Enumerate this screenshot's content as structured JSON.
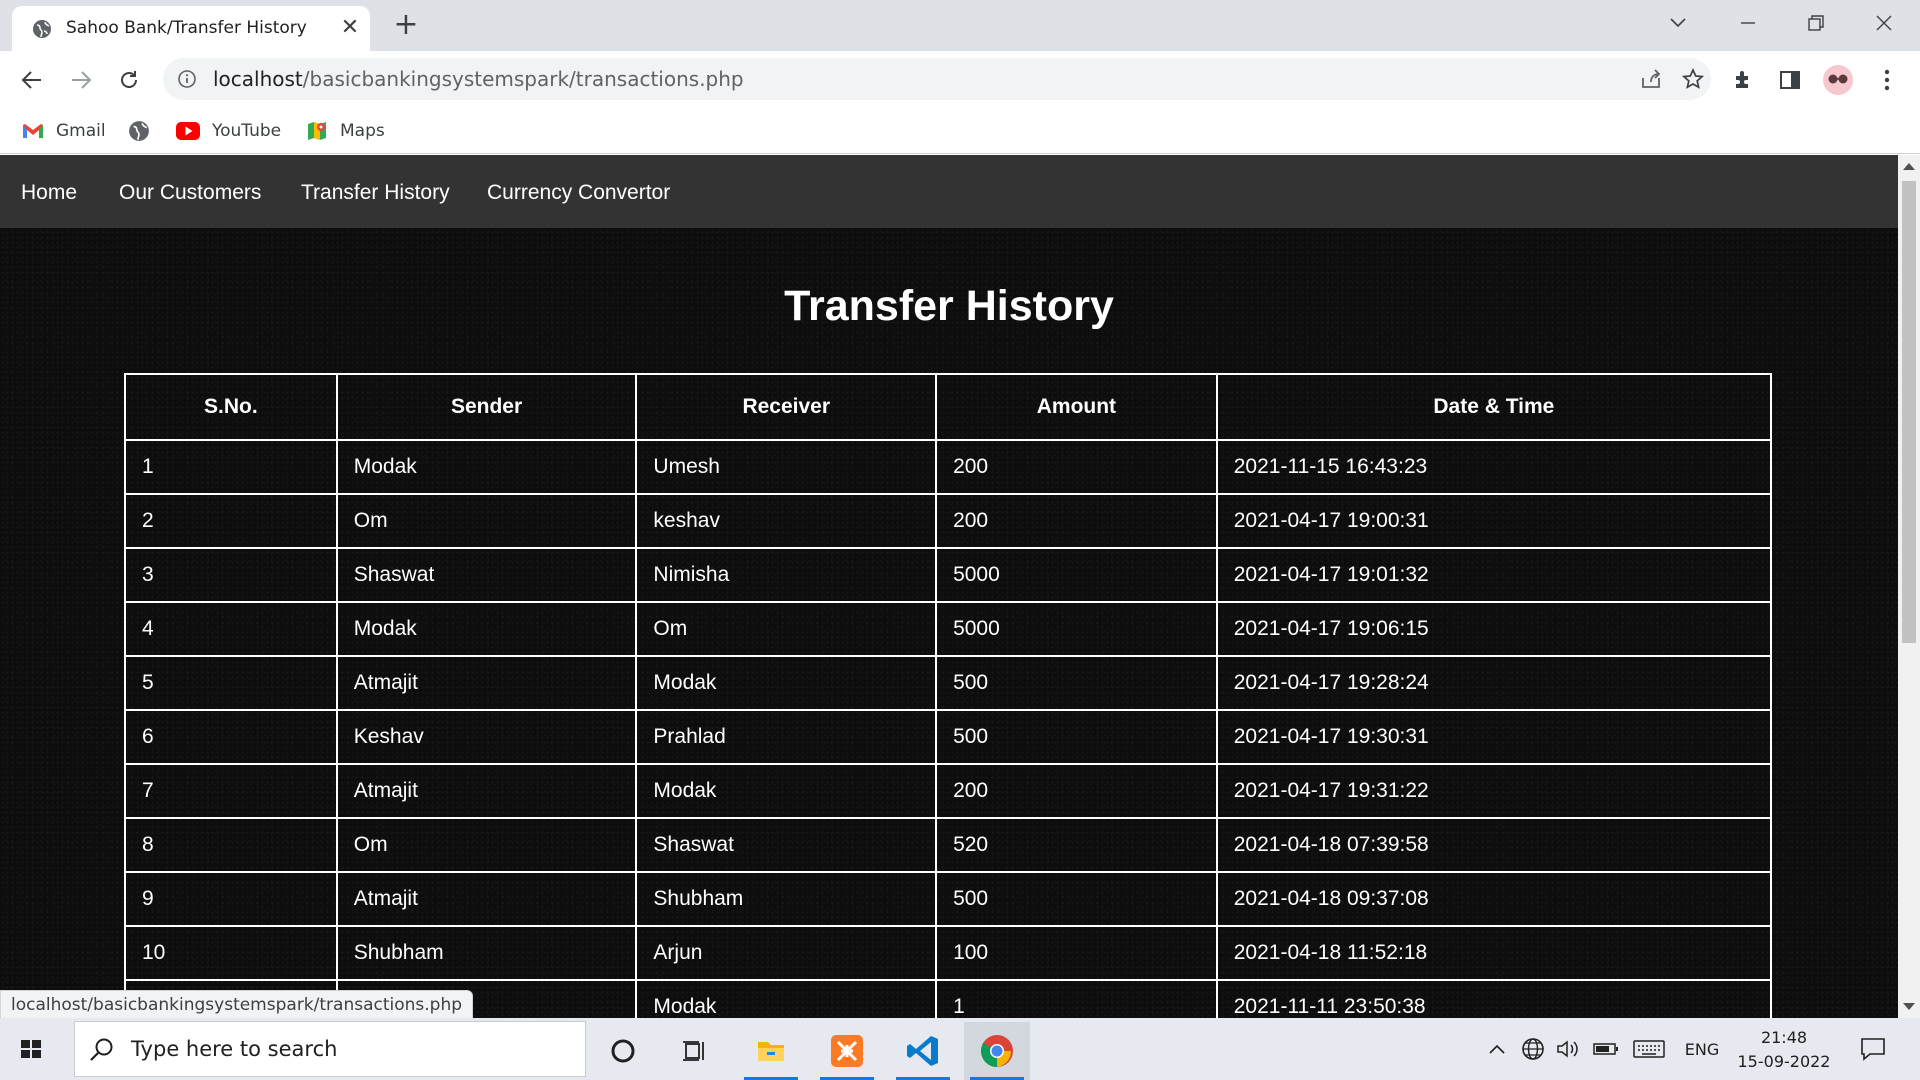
{
  "browser": {
    "tab_title": "Sahoo Bank/Transfer History",
    "url_host": "localhost",
    "url_path": "/basicbankingsystemspark/transactions.php",
    "bookmarks": [
      {
        "label": "Gmail"
      },
      {
        "label": ""
      },
      {
        "label": "YouTube"
      },
      {
        "label": "Maps"
      }
    ],
    "status_url": "localhost/basicbankingsystemspark/transactions.php"
  },
  "site": {
    "nav": [
      {
        "label": "Home"
      },
      {
        "label": "Our Customers"
      },
      {
        "label": "Transfer History"
      },
      {
        "label": "Currency Convertor"
      }
    ],
    "title": "Transfer History"
  },
  "table": {
    "headers": [
      "S.No.",
      "Sender",
      "Receiver",
      "Amount",
      "Date & Time"
    ],
    "rows": [
      [
        "1",
        "Modak",
        "Umesh",
        "200",
        "2021-11-15 16:43:23"
      ],
      [
        "2",
        "Om",
        "keshav",
        "200",
        "2021-04-17 19:00:31"
      ],
      [
        "3",
        "Shaswat",
        "Nimisha",
        "5000",
        "2021-04-17 19:01:32"
      ],
      [
        "4",
        "Modak",
        "Om",
        "5000",
        "2021-04-17 19:06:15"
      ],
      [
        "5",
        "Atmajit",
        "Modak",
        "500",
        "2021-04-17 19:28:24"
      ],
      [
        "6",
        "Keshav",
        "Prahlad",
        "500",
        "2021-04-17 19:30:31"
      ],
      [
        "7",
        "Atmajit",
        "Modak",
        "200",
        "2021-04-17 19:31:22"
      ],
      [
        "8",
        "Om",
        "Shaswat",
        "520",
        "2021-04-18 07:39:58"
      ],
      [
        "9",
        "Atmajit",
        "Shubham",
        "500",
        "2021-04-18 09:37:08"
      ],
      [
        "10",
        "Shubham",
        "Arjun",
        "100",
        "2021-04-18 11:52:18"
      ],
      [
        "",
        "",
        "Modak",
        "1",
        "2021-11-11 23:50:38"
      ]
    ]
  },
  "taskbar": {
    "search_placeholder": "Type here to search",
    "language": "ENG",
    "time": "21:48",
    "date": "15-09-2022"
  },
  "colors": {
    "nav_bar": "#333333",
    "page_bg": "#0d0d0d",
    "text": "#ffffff",
    "table_border": "#ffffff"
  }
}
